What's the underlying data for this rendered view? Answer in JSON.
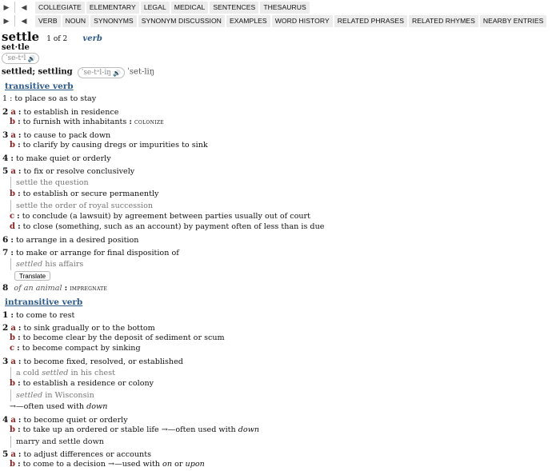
{
  "nav1": {
    "tabs": [
      "COLLEGIATE",
      "ELEMENTARY",
      "LEGAL",
      "MEDICAL",
      "SENTENCES",
      "THESAURUS"
    ]
  },
  "nav2": {
    "tabs": [
      "VERB",
      "NOUN",
      "SYNONYMS",
      "SYNONYM DISCUSSION",
      "EXAMPLES",
      "WORD HISTORY",
      "RELATED PHRASES",
      "RELATED RHYMES",
      "NEARBY ENTRIES"
    ]
  },
  "entry": {
    "headword": "settle",
    "homograph": "1 of 2",
    "pos": "verb",
    "syllables": "set·tle",
    "pron": "ˈse-tᵊl",
    "inflections": "settled; settling",
    "inflection_pron1": "ˈse-tᵊl-iŋ",
    "inflection_pron2": "ˈset-liŋ"
  },
  "transitive": {
    "heading": "transitive verb",
    "s1": "1 : to place so as to stay",
    "s2a": "to establish in residence",
    "s2b": "to furnish with inhabitants",
    "s2b_x": "colonize",
    "s3a": "to cause to pack down",
    "s3b": "to clarify by causing dregs or impurities to sink",
    "s4": "to make quiet or orderly",
    "s5a": "to fix or resolve conclusively",
    "s5a_ex": "settle the question",
    "s5b": "to establish or secure permanently",
    "s5b_ex": "settle the order of royal succession",
    "s5c": "to conclude (a lawsuit) by agreement between parties usually out of court",
    "s5d": "to close (something, such as an account) by payment often of less than is due",
    "s6": "to arrange in a desired position",
    "s7": "to make or arrange for final disposition of",
    "s7_ex_it": "settled",
    "s7_ex": "his affairs",
    "translate": "Translate",
    "s8_it": "of an animal",
    "s8_x": "impregnate"
  },
  "intransitive": {
    "heading": "intransitive verb",
    "s1": "to come to rest",
    "s2a": "to sink gradually or to the bottom",
    "s2b": "to become clear by the deposit of sediment or scum",
    "s2c": "to become compact by sinking",
    "s3a": "to become fixed, resolved, or established",
    "s3a_ex1": "a cold",
    "s3a_ex_it": "settled",
    "s3a_ex2": "in his chest",
    "s3b": "to establish a residence or colony",
    "s3b_ex_it": "settled",
    "s3b_ex": "in Wisconsin",
    "s3_note": "—often used with",
    "s3_note_it": "down",
    "s4a": "to become quiet or orderly",
    "s4b": "to take up an ordered or stable life",
    "s4b_note": "—often used with",
    "s4b_note_it": "down",
    "s4b_ex": "marry and settle down",
    "s5a": "to adjust differences or accounts",
    "s5b": "to come to a decision",
    "s5b_note": "—used with",
    "s5b_it1": "on",
    "s5b_or": "or",
    "s5b_it2": "upon"
  },
  "nums": {
    "n1": "1",
    "n2": "2",
    "n3": "3",
    "n4": "4",
    "n5": "5",
    "n6": "6",
    "n7": "7",
    "n8": "8"
  },
  "lets": {
    "a": "a",
    "b": "b",
    "c": "c",
    "d": "d"
  },
  "colors": {
    "heading": "#2d5a89",
    "letter": "#8b1f1f",
    "tab_bg": "#ececec"
  },
  "icons": {
    "back": "back-arrow-icon",
    "forward": "forward-arrow-icon",
    "speaker": "speaker-icon",
    "cross_ref": "arrow-right-icon"
  }
}
